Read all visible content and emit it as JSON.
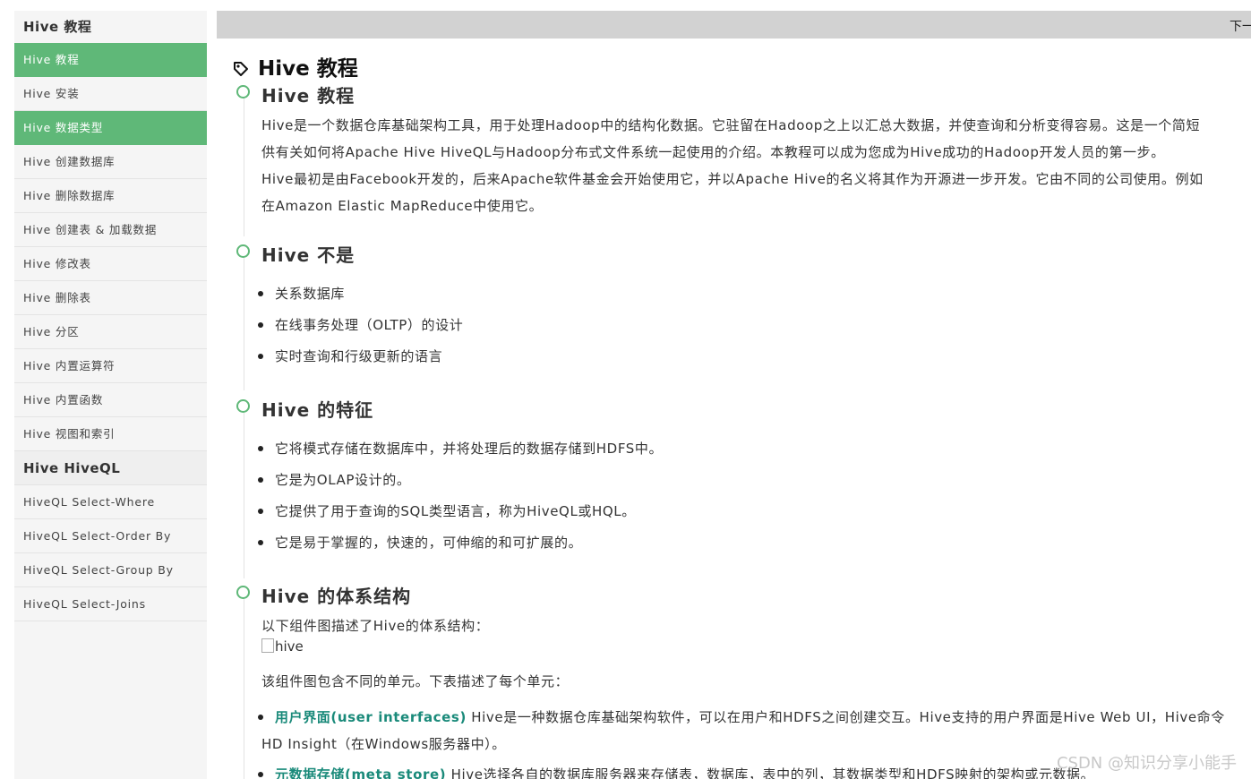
{
  "sidebar": {
    "heading": "Hive 教程",
    "items": [
      {
        "label": "Hive 教程",
        "active": true
      },
      {
        "label": "Hive 安装",
        "active": false
      },
      {
        "label": "Hive 数据类型",
        "active": true
      },
      {
        "label": "Hive 创建数据库",
        "active": false
      },
      {
        "label": "Hive 删除数据库",
        "active": false
      },
      {
        "label": "Hive 创建表 & 加载数据",
        "active": false
      },
      {
        "label": "Hive 修改表",
        "active": false
      },
      {
        "label": "Hive 删除表",
        "active": false
      },
      {
        "label": "Hive 分区",
        "active": false
      },
      {
        "label": "Hive 内置运算符",
        "active": false
      },
      {
        "label": "Hive 内置函数",
        "active": false
      },
      {
        "label": "Hive 视图和索引",
        "active": false
      }
    ],
    "heading2": "Hive HiveQL",
    "items2": [
      {
        "label": "HiveQL Select-Where"
      },
      {
        "label": "HiveQL Select-Order By"
      },
      {
        "label": "HiveQL Select-Group By"
      },
      {
        "label": "HiveQL Select-Joins"
      }
    ],
    "active_color": "#5fb878"
  },
  "topbar": {
    "next_label": "下一"
  },
  "main": {
    "page_title": "Hive 教程",
    "title_icon": "tag-icon",
    "sections": {
      "intro": {
        "title": "Hive 教程",
        "lines": [
          "Hive是一个数据仓库基础架构工具，用于处理Hadoop中的结构化数据。它驻留在Hadoop之上以汇总大数据，并使查询和分析变得容易。这是一个简短",
          "供有关如何将Apache Hive HiveQL与Hadoop分布式文件系统一起使用的介绍。本教程可以成为您成为Hive成功的Hadoop开发人员的第一步。",
          "Hive最初是由Facebook开发的，后来Apache软件基金会开始使用它，并以Apache Hive的名义将其作为开源进一步开发。它由不同的公司使用。例如",
          "在Amazon Elastic MapReduce中使用它。"
        ]
      },
      "not": {
        "title": "Hive 不是",
        "bullets": [
          "关系数据库",
          "在线事务处理（OLTP）的设计",
          "实时查询和行级更新的语言"
        ]
      },
      "features": {
        "title": "Hive 的特征",
        "bullets": [
          "它将模式存储在数据库中，并将处理后的数据存储到HDFS中。",
          "它是为OLAP设计的。",
          "它提供了用于查询的SQL类型语言，称为HiveQL或HQL。",
          "它是易于掌握的，快速的，可伸缩的和可扩展的。"
        ]
      },
      "architecture": {
        "title": "Hive 的体系结构",
        "intro": "以下组件图描述了Hive的体系结构：",
        "image_alt": "hive",
        "desc": "该组件图包含不同的单元。下表描述了每个单元：",
        "units": [
          {
            "term": "用户界面(user interfaces)",
            "text": " Hive是一种数据仓库基础架构软件，可以在用户和HDFS之间创建交互。Hive支持的用户界面是Hive Web UI，Hive命令",
            "cont": "HD Insight（在Windows服务器中）。"
          },
          {
            "term": "元数据存储(meta store)",
            "text": " Hive选择各自的数据库服务器来存储表，数据库，表中的列，其数据类型和HDFS映射的架构或元数据。"
          }
        ]
      }
    },
    "accent": "#5fb878",
    "term_color": "#1a8a7a"
  },
  "watermark": "CSDN @知识分享小能手"
}
